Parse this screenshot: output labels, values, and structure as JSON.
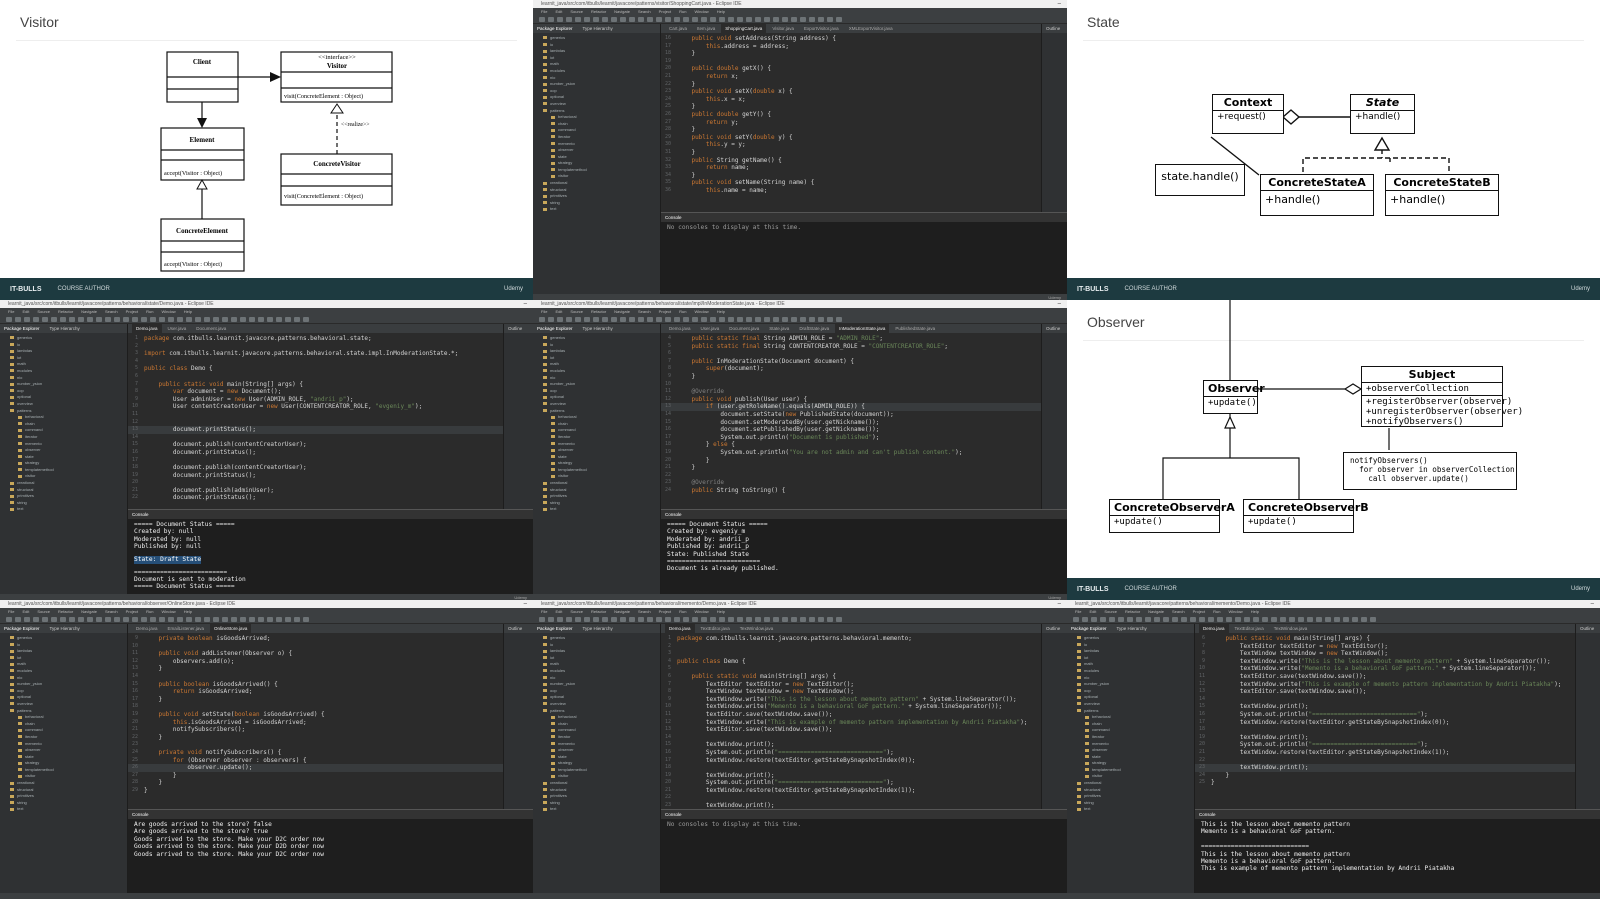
{
  "visitor_slide": {
    "title": "Visitor",
    "client": "Client",
    "visitor_stereotype": "<<interface>>",
    "visitor_name": "Visitor",
    "visitor_method": "visit(ConcreteElement : Object)",
    "element_name": "Element",
    "element_method": "accept(Visitor : Object)",
    "realize_label": "<<realize>>",
    "concrete_visitor_name": "ConcreteVisitor",
    "concrete_visitor_method": "visit(ConcreteElement : Object)",
    "concrete_element_name": "ConcreteElement",
    "concrete_element_method": "accept(Visitor : Object)",
    "footer_logo": "IT-BULLS",
    "footer_text": "COURSE AUTHOR",
    "footer_udemy": "Udemy"
  },
  "state_slide": {
    "title": "State",
    "context_name": "Context",
    "context_method": "+request()",
    "state_name": "State",
    "state_method": "+handle()",
    "note": "state.handle()",
    "concrete_a_name": "ConcreteStateA",
    "concrete_a_method": "+handle()",
    "concrete_b_name": "ConcreteStateB",
    "concrete_b_method": "+handle()",
    "footer_logo": "IT-BULLS",
    "footer_text": "COURSE AUTHOR",
    "footer_udemy": "Udemy"
  },
  "observer_slide": {
    "title": "Observer",
    "observer_name": "Observer",
    "observer_method": "+update()",
    "subject_name": "Subject",
    "subject_field": "+observerCollection",
    "subject_methods": [
      "+registerObserver(observer)",
      "+unregisterObserver(observer)",
      "+notifyObservers()"
    ],
    "note": "notifyObservers()\n  for observer in observerCollection\n    call observer.update()",
    "concrete_a_name": "ConcreteObserverA",
    "concrete_a_method": "+update()",
    "concrete_b_name": "ConcreteObserverB",
    "concrete_b_method": "+update()",
    "footer_logo": "IT-BULLS",
    "footer_text": "COURSE AUTHOR",
    "footer_udemy": "Udemy"
  },
  "ide": {
    "menu": [
      "File",
      "Edit",
      "Source",
      "Refactor",
      "Navigate",
      "Search",
      "Project",
      "Run",
      "Window",
      "Help"
    ],
    "explorer_title": "Package Explorer",
    "explorer_tab2": "Type Hierarchy",
    "outline_title": "Outline",
    "console_tab": "Console",
    "tree": [
      "generics",
      "io",
      "lambdas",
      "iot",
      "math",
      "modules",
      "nio",
      "number_ysion",
      "oop",
      "optional",
      "overview",
      "patterns",
      "behavioral",
      "chain",
      "command",
      "iterator",
      "memento",
      "observer",
      "state",
      "strategy",
      "templatemethod",
      "visitor",
      "creational",
      "structural",
      "primitives",
      "string",
      "text"
    ]
  },
  "ide1": {
    "title": "learnit_java/src/com/itbulls/learnit/javacore/patterns/visitor/ShoppingCart.java - Eclipse IDE",
    "tabs": [
      "Cart.java",
      "Item.java",
      "ShoppingCart.java",
      "Visitor.java",
      "ExportVisitor.java",
      "XMLExportVisitor.java"
    ],
    "active_tab": "ShoppingCart.java",
    "code": [
      [
        "16",
        "    public void setAddress(String address) {"
      ],
      [
        "17",
        "        this.address = address;"
      ],
      [
        "18",
        "    }"
      ],
      [
        "19",
        ""
      ],
      [
        "20",
        "    public double getX() {"
      ],
      [
        "21",
        "        return x;"
      ],
      [
        "22",
        "    }"
      ],
      [
        "23",
        "    public void setX(double x) {"
      ],
      [
        "24",
        "        this.x = x;"
      ],
      [
        "25",
        "    }"
      ],
      [
        "26",
        "    public double getY() {"
      ],
      [
        "27",
        "        return y;"
      ],
      [
        "28",
        "    }"
      ],
      [
        "29",
        "    public void setY(double y) {"
      ],
      [
        "30",
        "        this.y = y;"
      ],
      [
        "31",
        "    }"
      ],
      [
        "32",
        "    public String getName() {"
      ],
      [
        "33",
        "        return name;"
      ],
      [
        "34",
        "    }"
      ],
      [
        "35",
        "    public void setName(String name) {"
      ],
      [
        "36",
        "        this.name = name;"
      ]
    ],
    "console_note": "No consoles to display at this time."
  },
  "ide2": {
    "title": "learnit_java/src/com/itbulls/learnit/javacore/patterns/behavioral/state/Demo.java - Eclipse IDE",
    "tabs": [
      "Demo.java",
      "User.java",
      "Document.java"
    ],
    "active_tab": "Demo.java",
    "code": [
      [
        "1",
        "package com.itbulls.learnit.javacore.patterns.behavioral.state;"
      ],
      [
        "2",
        ""
      ],
      [
        "3",
        "import com.itbulls.learnit.javacore.patterns.behavioral.state.impl.InModerationState.*;"
      ],
      [
        "4",
        ""
      ],
      [
        "5",
        "public class Demo {"
      ],
      [
        "6",
        ""
      ],
      [
        "7",
        "    public static void main(String[] args) {"
      ],
      [
        "8",
        "        var document = new Document();"
      ],
      [
        "9",
        "        User adminUser = new User(ADMIN_ROLE, \"andrii_p\");"
      ],
      [
        "10",
        "        User contentCreatorUser = new User(CONTENTCREATOR_ROLE, \"evgeniy_m\");"
      ],
      [
        "11",
        ""
      ],
      [
        "12",
        ""
      ],
      [
        "13",
        "        document.printStatus();"
      ],
      [
        "14",
        ""
      ],
      [
        "15",
        "        document.publish(contentCreatorUser);"
      ],
      [
        "16",
        "        document.printStatus();"
      ],
      [
        "17",
        ""
      ],
      [
        "18",
        "        document.publish(contentCreatorUser);"
      ],
      [
        "19",
        "        document.printStatus();"
      ],
      [
        "20",
        ""
      ],
      [
        "21",
        "        document.publish(adminUser);"
      ],
      [
        "22",
        "        document.printStatus();"
      ]
    ],
    "console": [
      "===== Document Status =====",
      "Created by: null",
      "Moderated by: null",
      "Published by: null",
      "State: Draft State",
      "=========================",
      "Document is sent to moderation",
      "===== Document Status ====="
    ]
  },
  "ide3": {
    "title": "learnit_java/src/com/itbulls/learnit/javacore/patterns/behavioral/state/impl/InModerationState.java - Eclipse IDE",
    "tabs": [
      "Demo.java",
      "User.java",
      "Document.java",
      "State.java",
      "DraftState.java",
      "InModerationState.java",
      "PublishedState.java"
    ],
    "active_tab": "InModerationState.java",
    "code": [
      [
        "4",
        "    public static final String ADMIN_ROLE = \"ADMIN_ROLE\";"
      ],
      [
        "5",
        "    public static final String CONTENTCREATOR_ROLE = \"CONTENTCREATOR_ROLE\";"
      ],
      [
        "6",
        ""
      ],
      [
        "7",
        "    public InModerationState(Document document) {"
      ],
      [
        "8",
        "        super(document);"
      ],
      [
        "9",
        "    }"
      ],
      [
        "10",
        ""
      ],
      [
        "11",
        "    @Override"
      ],
      [
        "12",
        "    public void publish(User user) {"
      ],
      [
        "13",
        "        if (user.getRoleName().equals(ADMIN_ROLE)) {"
      ],
      [
        "14",
        "            document.setState(new PublishedState(document));"
      ],
      [
        "15",
        "            document.setModeratedBy(user.getNickname());"
      ],
      [
        "16",
        "            document.setPublishedBy(user.getNickname());"
      ],
      [
        "17",
        "            System.out.println(\"Document is published\");"
      ],
      [
        "18",
        "        } else {"
      ],
      [
        "19",
        "            System.out.println(\"You are not admin and can't publish content.\");"
      ],
      [
        "20",
        "        }"
      ],
      [
        "21",
        "    }"
      ],
      [
        "22",
        ""
      ],
      [
        "23",
        "    @Override"
      ],
      [
        "24",
        "    public String toString() {"
      ]
    ],
    "console": [
      "===== Document Status =====",
      "Created by: evgeniy_m",
      "Moderated by: andrii_p",
      "Published by: andrii_p",
      "State: Published State",
      "=========================",
      "Document is already published."
    ]
  },
  "ide4": {
    "title": "learnit_java/src/com/itbulls/learnit/javacore/patterns/behavioral/observer/OnlineStore.java - Eclipse IDE",
    "tabs": [
      "Demo.java",
      "EmailListener.java",
      "OnlineStore.java"
    ],
    "active_tab": "OnlineStore.java",
    "code": [
      [
        "9",
        "    private boolean isGoodsArrived;"
      ],
      [
        "10",
        ""
      ],
      [
        "11",
        "    public void addListener(Observer o) {"
      ],
      [
        "12",
        "        observers.add(o);"
      ],
      [
        "13",
        "    }"
      ],
      [
        "14",
        ""
      ],
      [
        "15",
        "    public boolean isGoodsArrived() {"
      ],
      [
        "16",
        "        return isGoodsArrived;"
      ],
      [
        "17",
        "    }"
      ],
      [
        "18",
        ""
      ],
      [
        "19",
        "    public void setState(boolean isGoodsArrived) {"
      ],
      [
        "20",
        "        this.isGoodsArrived = isGoodsArrived;"
      ],
      [
        "21",
        "        notifySubscribers();"
      ],
      [
        "22",
        "    }"
      ],
      [
        "23",
        ""
      ],
      [
        "24",
        "    private void notifySubscribers() {"
      ],
      [
        "25",
        "        for (Observer observer : observers) {"
      ],
      [
        "26",
        "            observer.update();"
      ],
      [
        "27",
        "        }"
      ],
      [
        "28",
        "    }"
      ],
      [
        "29",
        "}"
      ]
    ],
    "console": [
      "Are goods arrived to the store? false",
      "Are goods arrived to the store? true",
      "Goods arrived to the store. Make your D2C order now",
      "Goods arrived to the store. Make your D2D order now",
      "Goods arrived to the store. Make your D2C order now"
    ]
  },
  "ide5": {
    "title": "learnit_java/src/com/itbulls/learnit/javacore/patterns/behavioral/memento/Demo.java - Eclipse IDE",
    "tabs": [
      "Demo.java",
      "TextEditor.java",
      "TextWindow.java"
    ],
    "active_tab": "Demo.java",
    "code": [
      [
        "1",
        "package com.itbulls.learnit.javacore.patterns.behavioral.memento;"
      ],
      [
        "2",
        ""
      ],
      [
        "3",
        ""
      ],
      [
        "4",
        "public class Demo {"
      ],
      [
        "5",
        ""
      ],
      [
        "6",
        "    public static void main(String[] args) {"
      ],
      [
        "7",
        "        TextEditor textEditor = new TextEditor();"
      ],
      [
        "8",
        "        TextWindow textWindow = new TextWindow();"
      ],
      [
        "9",
        "        textWindow.write(\"This is the lesson about memento pattern\" + System.lineSeparator());"
      ],
      [
        "10",
        "        textWindow.write(\"Memento is a behavioral GoF pattern.\" + System.lineSeparator());"
      ],
      [
        "11",
        "        textEditor.save(textWindow.save());"
      ],
      [
        "12",
        "        textWindow.write(\"This is example of memento pattern implementation by Andrii Piatakha\");"
      ],
      [
        "13",
        "        textEditor.save(textWindow.save());"
      ],
      [
        "14",
        ""
      ],
      [
        "15",
        "        textWindow.print();"
      ],
      [
        "16",
        "        System.out.println(\"=============================\");"
      ],
      [
        "17",
        "        textWindow.restore(textEditor.getStateBySnapshotIndex(0));"
      ],
      [
        "18",
        ""
      ],
      [
        "19",
        "        textWindow.print();"
      ],
      [
        "20",
        "        System.out.println(\"=============================\");"
      ],
      [
        "21",
        "        textWindow.restore(textEditor.getStateBySnapshotIndex(1));"
      ],
      [
        "22",
        ""
      ],
      [
        "23",
        "        textWindow.print();"
      ]
    ],
    "console_note": "No consoles to display at this time."
  },
  "ide6": {
    "title": "learnit_java/src/com/itbulls/learnit/javacore/patterns/behavioral/memento/Demo.java - Eclipse IDE",
    "tabs": [
      "Demo.java",
      "TextEditor.java",
      "TextWindow.java"
    ],
    "active_tab": "Demo.java",
    "code": [
      [
        "6",
        "    public static void main(String[] args) {"
      ],
      [
        "7",
        "        TextEditor textEditor = new TextEditor();"
      ],
      [
        "8",
        "        TextWindow textWindow = new TextWindow();"
      ],
      [
        "9",
        "        textWindow.write(\"This is the lesson about memento pattern\" + System.lineSeparator());"
      ],
      [
        "10",
        "        textWindow.write(\"Memento is a behavioral GoF pattern.\" + System.lineSeparator());"
      ],
      [
        "11",
        "        textEditor.save(textWindow.save());"
      ],
      [
        "12",
        "        textWindow.write(\"This is example of memento pattern implementation by Andrii Piatakha\");"
      ],
      [
        "13",
        "        textEditor.save(textWindow.save());"
      ],
      [
        "14",
        ""
      ],
      [
        "15",
        "        textWindow.print();"
      ],
      [
        "16",
        "        System.out.println(\"=============================\");"
      ],
      [
        "17",
        "        textWindow.restore(textEditor.getStateBySnapshotIndex(0));"
      ],
      [
        "18",
        ""
      ],
      [
        "19",
        "        textWindow.print();"
      ],
      [
        "20",
        "        System.out.println(\"=============================\");"
      ],
      [
        "21",
        "        textWindow.restore(textEditor.getStateBySnapshotIndex(1));"
      ],
      [
        "22",
        ""
      ],
      [
        "23",
        "        textWindow.print();"
      ],
      [
        "24",
        "    }"
      ],
      [
        "25",
        "}"
      ]
    ],
    "console": [
      "This is the lesson about memento pattern",
      "Memento is a behavioral GoF pattern.",
      "",
      "=============================",
      "This is the lesson about memento pattern",
      "Memento is a behavioral GoF pattern.",
      "This is example of memento pattern implementation by Andrii Piatakha"
    ]
  }
}
